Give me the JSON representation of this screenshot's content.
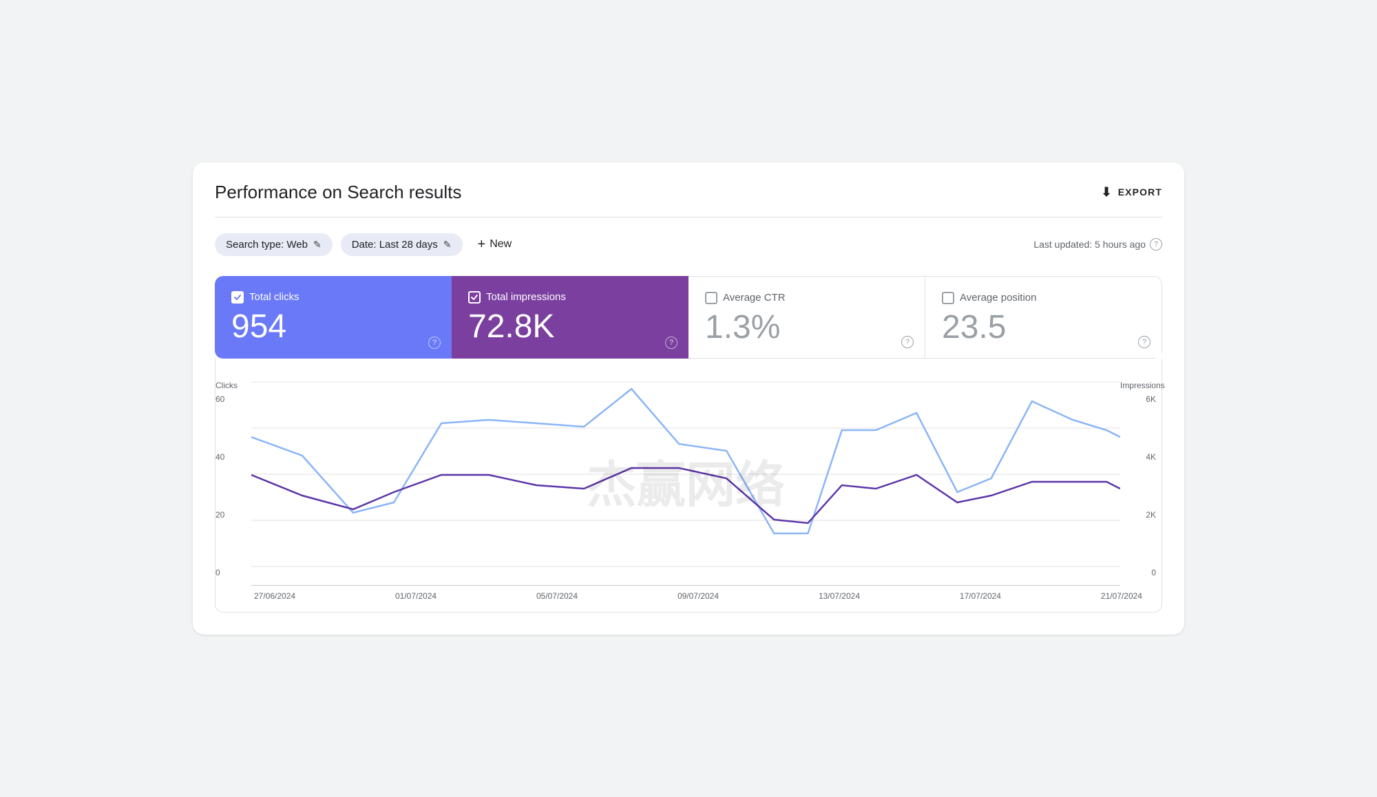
{
  "page": {
    "title": "Performance on Search results",
    "export_label": "EXPORT"
  },
  "filters": {
    "search_type_label": "Search type: Web",
    "date_label": "Date: Last 28 days",
    "new_label": "New",
    "last_updated": "Last updated: 5 hours ago"
  },
  "metrics": {
    "clicks": {
      "label": "Total clicks",
      "value": "954",
      "checked": true
    },
    "impressions": {
      "label": "Total impressions",
      "value": "72.8K",
      "checked": true
    },
    "ctr": {
      "label": "Average CTR",
      "value": "1.3%",
      "checked": false
    },
    "position": {
      "label": "Average position",
      "value": "23.5",
      "checked": false
    }
  },
  "chart": {
    "y_left_axis_title": "Clicks",
    "y_right_axis_title": "Impressions",
    "y_left_ticks": [
      "60",
      "40",
      "20",
      "0"
    ],
    "y_right_ticks": [
      "6K",
      "4K",
      "2K",
      "0"
    ],
    "x_labels": [
      "27/06/2024",
      "01/07/2024",
      "05/07/2024",
      "09/07/2024",
      "13/07/2024",
      "17/07/2024",
      "21/07/2024"
    ],
    "watermark": "杰赢网络"
  },
  "icons": {
    "export": "⬇",
    "edit": "✎",
    "plus": "+",
    "help": "?"
  }
}
